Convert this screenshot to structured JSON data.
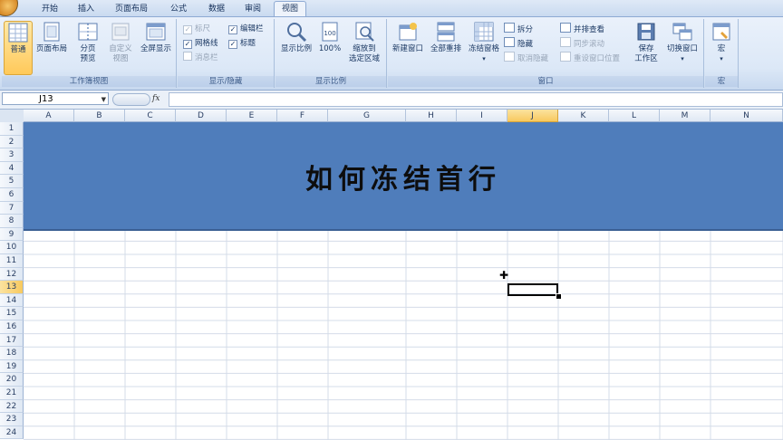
{
  "tabs": [
    {
      "label": "开始",
      "active": false
    },
    {
      "label": "插入",
      "active": false
    },
    {
      "label": "页面布局",
      "active": false
    },
    {
      "label": "公式",
      "active": false
    },
    {
      "label": "数据",
      "active": false
    },
    {
      "label": "审阅",
      "active": false
    },
    {
      "label": "视图",
      "active": true
    }
  ],
  "ribbon": {
    "workbook_views": {
      "label": "工作簿视图",
      "normal": "普通",
      "page_layout": "页面布局",
      "page_break_1": "分页",
      "page_break_2": "预览",
      "custom_1": "自定义",
      "custom_2": "视图",
      "fullscreen": "全屏显示"
    },
    "show_hide": {
      "label": "显示/隐藏",
      "ruler": "标尺",
      "formula_bar": "编辑栏",
      "gridlines": "网格线",
      "headings": "标题",
      "message_bar": "消息栏"
    },
    "zoom": {
      "label": "显示比例",
      "zoom": "显示比例",
      "hundred": "100%",
      "zoom_sel_1": "缩放到",
      "zoom_sel_2": "选定区域"
    },
    "window": {
      "label": "窗口",
      "new_window": "新建窗口",
      "arrange_all": "全部重排",
      "freeze_panes": "冻结窗格",
      "split": "拆分",
      "hide": "隐藏",
      "unhide": "取消隐藏",
      "side_by_side": "并排查看",
      "sync_scroll": "同步滚动",
      "reset_pos": "重设窗口位置",
      "save_ws_1": "保存",
      "save_ws_2": "工作区",
      "switch_windows": "切换窗口"
    },
    "macros": {
      "label": "宏",
      "macros": "宏"
    }
  },
  "formula_bar": {
    "name_box": "J13",
    "fx": "fx",
    "value": ""
  },
  "columns": [
    "A",
    "B",
    "C",
    "D",
    "E",
    "F",
    "G",
    "H",
    "I",
    "J",
    "K",
    "L",
    "M",
    "N"
  ],
  "rows": [
    "1",
    "2",
    "3",
    "4",
    "5",
    "6",
    "7",
    "8",
    "9",
    "10",
    "11",
    "12",
    "13",
    "14",
    "15",
    "16",
    "17",
    "18",
    "19",
    "20",
    "21",
    "22",
    "23",
    "24"
  ],
  "selected_column": "J",
  "selected_row": "13",
  "banner": {
    "title": "如何冻结首行",
    "color": "#4f7dbb"
  }
}
